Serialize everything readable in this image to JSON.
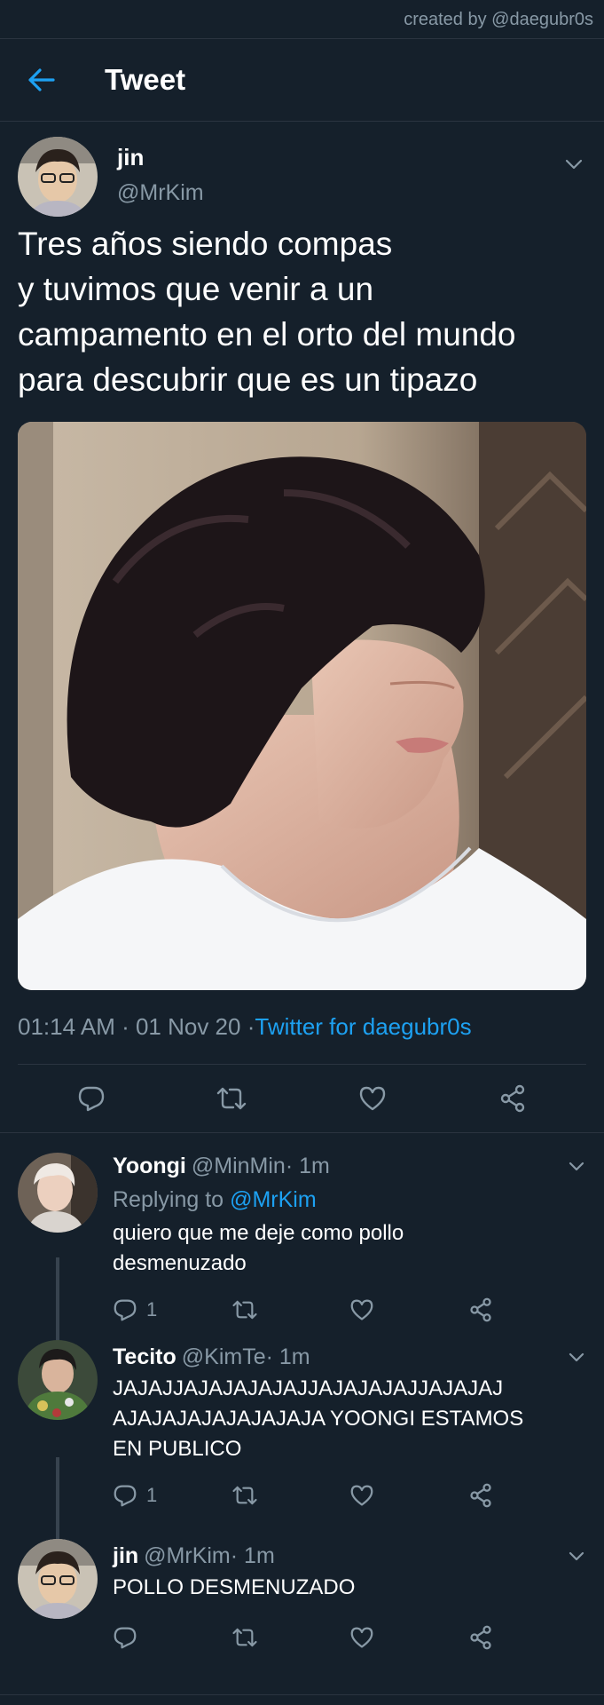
{
  "credit": "created by @daegubr0s",
  "header": {
    "title": "Tweet"
  },
  "tweet": {
    "author_name": "jin",
    "author_handle": "@MrKim",
    "text": "Tres años siendo compas\ny tuvimos que venir a un\ncampamento en el orto del mundo\npara descubrir que es un tipazo",
    "timestamp": "01:14 AM · 01 Nov 20 · ",
    "source": "Twitter for daegubr0s"
  },
  "icons": [
    "back-arrow-icon",
    "chevron-down-icon",
    "reply-icon",
    "retweet-icon",
    "like-icon",
    "share-icon"
  ],
  "replies": [
    {
      "name": "Yoongi",
      "handle": "@MinMin",
      "time": " · 1m",
      "replying_label": "Replying to",
      "replying_to": "@MrKim",
      "text": "quiero que me deje como pollo\ndesmenuzado",
      "reply_count": "1"
    },
    {
      "name": "Tecito",
      "handle": "@KimTe",
      "time": " · 1m",
      "text": "JAJAJJAJAJAJAJAJJAJAJAJAJJAJAJAJ\nAJAJAJAJAJAJAJAJA YOONGI ESTAMOS\nEN PUBLICO",
      "reply_count": "1"
    },
    {
      "name": "jin",
      "handle": "@MrKim",
      "time": " · 1m",
      "text": "POLLO DESMENUZADO"
    }
  ],
  "colors": {
    "background": "#15202b",
    "accent": "#1da1f2",
    "muted": "#8899a6",
    "divider": "#2b3440"
  }
}
